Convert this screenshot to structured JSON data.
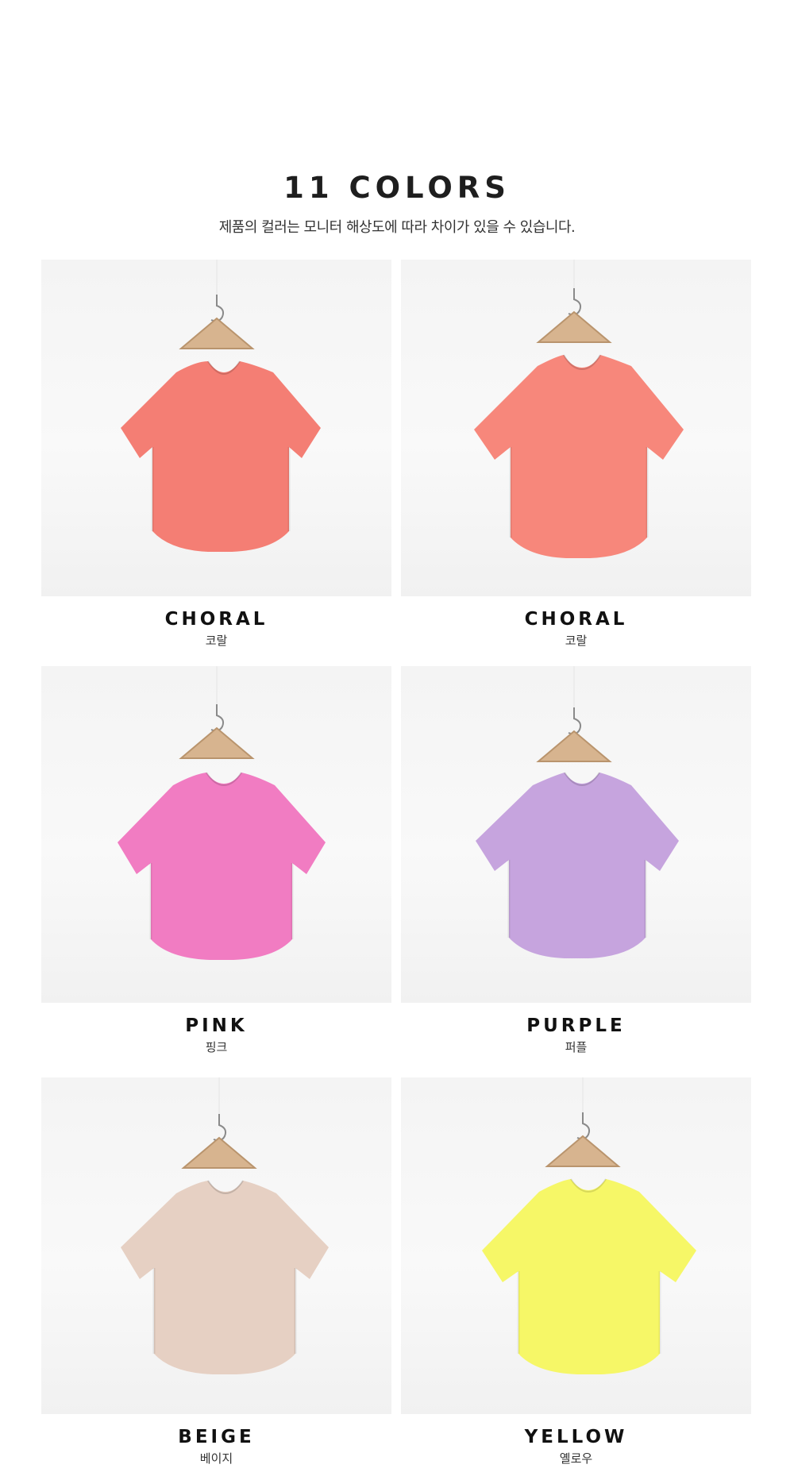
{
  "header": {
    "title": "11 COLORS",
    "subtitle": "제품의 컬러는 모니터 해상도에 따라 차이가 있을 수 있습니다."
  },
  "colors": [
    {
      "name_en": "CHORAL",
      "name_ko": "코랄",
      "shirt_color": "#f47e74",
      "icon": "tshirt-icon"
    },
    {
      "name_en": "CHORAL",
      "name_ko": "코랄",
      "shirt_color": "#f7877b",
      "icon": "tshirt-icon"
    },
    {
      "name_en": "PINK",
      "name_ko": "핑크",
      "shirt_color": "#f17cc2",
      "icon": "tshirt-icon"
    },
    {
      "name_en": "PURPLE",
      "name_ko": "퍼플",
      "shirt_color": "#c6a4de",
      "icon": "tshirt-icon"
    },
    {
      "name_en": "BEIGE",
      "name_ko": "베이지",
      "shirt_color": "#e6d0c3",
      "icon": "tshirt-icon"
    },
    {
      "name_en": "YELLOW",
      "name_ko": "옐로우",
      "shirt_color": "#f6f767",
      "icon": "tshirt-icon"
    }
  ]
}
